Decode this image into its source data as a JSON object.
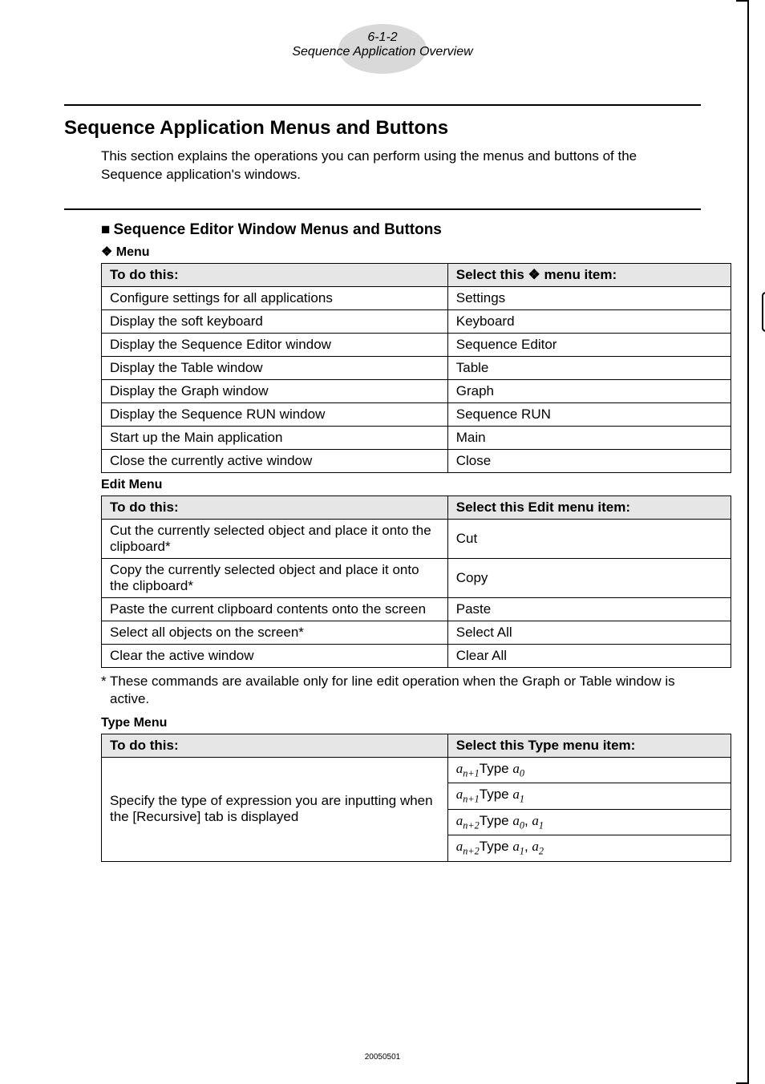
{
  "header": {
    "page_num": "6-1-2",
    "page_title": "Sequence Application Overview"
  },
  "main": {
    "heading": "Sequence Application Menus and Buttons",
    "intro": "This section explains the operations you can perform using the menus and buttons of the Sequence application's windows."
  },
  "section1": {
    "heading_prefix": "■ ",
    "heading": "Sequence Editor Window Menus and Buttons"
  },
  "menu_table": {
    "subheading": "Menu",
    "col1": "To do this:",
    "col2_pre": "Select this ",
    "col2_post": " menu item:",
    "rows": [
      {
        "l": "Configure settings for all applications",
        "r": "Settings"
      },
      {
        "l": "Display the soft keyboard",
        "r": "Keyboard"
      },
      {
        "l": "Display the Sequence Editor window",
        "r": "Sequence Editor"
      },
      {
        "l": "Display the Table window",
        "r": "Table"
      },
      {
        "l": "Display the Graph window",
        "r": "Graph"
      },
      {
        "l": "Display the Sequence RUN window",
        "r": "Sequence RUN"
      },
      {
        "l": "Start up the Main application",
        "r": "Main"
      },
      {
        "l": "Close the currently active window",
        "r": "Close"
      }
    ]
  },
  "edit_table": {
    "subheading": "Edit Menu",
    "col1": "To do this:",
    "col2": "Select this Edit menu item:",
    "rows": [
      {
        "l": "Cut the currently selected object and place it onto the clipboard*",
        "r": "Cut"
      },
      {
        "l": "Copy the currently selected object and place it onto the clipboard*",
        "r": "Copy"
      },
      {
        "l": "Paste the current clipboard contents onto the screen",
        "r": "Paste"
      },
      {
        "l": "Select all objects on the screen*",
        "r": "Select All"
      },
      {
        "l": "Clear the active window",
        "r": "Clear All"
      }
    ],
    "footnote": "* These commands are available only for line edit operation when the Graph or Table window is active."
  },
  "type_table": {
    "subheading": "Type Menu",
    "col1": "To do this:",
    "col2": "Select this Type menu item:",
    "left_merged": "Specify the type of expression you are inputting when the [Recursive] tab is displayed",
    "rows": [
      {
        "a": "a",
        "suf": "n+1",
        "rest": "Type ",
        "a2": "a",
        "suf2": "0"
      },
      {
        "a": "a",
        "suf": "n+1",
        "rest": "Type ",
        "a2": "a",
        "suf2": "1"
      },
      {
        "a": "a",
        "suf": "n+2",
        "rest": "Type ",
        "a2": "a",
        "suf2": "0",
        "comma": ", ",
        "a3": "a",
        "suf3": "1"
      },
      {
        "a": "a",
        "suf": "n+2",
        "rest": "Type ",
        "a2": "a",
        "suf2": "1",
        "comma": ", ",
        "a3": "a",
        "suf3": "2"
      }
    ]
  },
  "footer_id": "20050501",
  "icons": {
    "leaf": "❖",
    "square": "■",
    "side_icon": "calculator-icon"
  }
}
